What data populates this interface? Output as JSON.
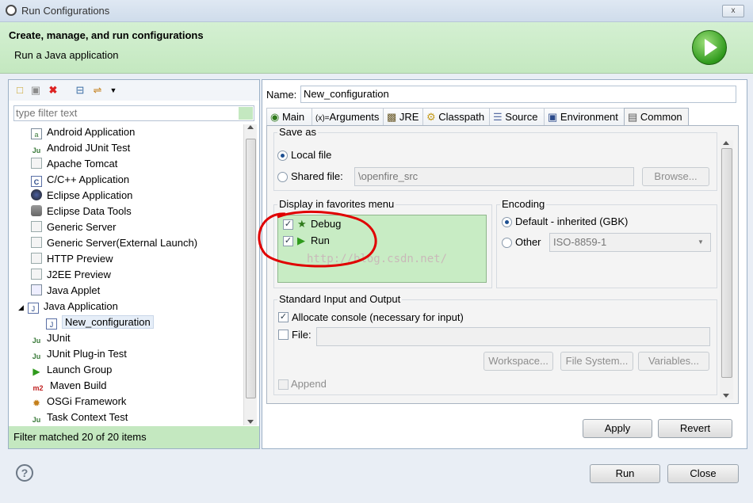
{
  "window": {
    "title": "Run Configurations",
    "close_label": "x"
  },
  "header": {
    "title": "Create, manage, and run configurations",
    "subtitle": "Run a Java application"
  },
  "left": {
    "filter_placeholder": "type filter text",
    "items": [
      {
        "label": "Android Application",
        "icon": "android-app-icon"
      },
      {
        "label": "Android JUnit Test",
        "icon": "junit-icon"
      },
      {
        "label": "Apache Tomcat",
        "icon": "tomcat-icon"
      },
      {
        "label": "C/C++ Application",
        "icon": "c-app-icon"
      },
      {
        "label": "Eclipse Application",
        "icon": "eclipse-icon"
      },
      {
        "label": "Eclipse Data Tools",
        "icon": "database-icon"
      },
      {
        "label": "Generic Server",
        "icon": "server-icon"
      },
      {
        "label": "Generic Server(External Launch)",
        "icon": "server-icon"
      },
      {
        "label": "HTTP Preview",
        "icon": "server-icon"
      },
      {
        "label": "J2EE Preview",
        "icon": "server-icon"
      },
      {
        "label": "Java Applet",
        "icon": "applet-icon"
      },
      {
        "label": "Java Application",
        "icon": "java-app-icon"
      },
      {
        "label": "New_configuration",
        "icon": "java-app-icon"
      },
      {
        "label": "JUnit",
        "icon": "junit-icon"
      },
      {
        "label": "JUnit Plug-in Test",
        "icon": "junit-icon"
      },
      {
        "label": "Launch Group",
        "icon": "launch-group-icon"
      },
      {
        "label": "Maven Build",
        "icon": "maven-icon"
      },
      {
        "label": "OSGi Framework",
        "icon": "osgi-icon"
      },
      {
        "label": "Task Context Test",
        "icon": "junit-icon"
      }
    ],
    "status": "Filter matched 20 of 20 items"
  },
  "config": {
    "name_label": "Name:",
    "name_value": "New_configuration",
    "tabs": [
      "Main",
      "Arguments",
      "JRE",
      "Classpath",
      "Source",
      "Environment",
      "Common"
    ],
    "active_tab": "Common"
  },
  "common": {
    "save_as_title": "Save as",
    "local_file_label": "Local file",
    "shared_file_label": "Shared file:",
    "shared_file_value": "\\openfire_src",
    "browse_label": "Browse...",
    "favorites_title": "Display in favorites menu",
    "debug_label": "Debug",
    "run_label": "Run",
    "encoding_title": "Encoding",
    "default_enc_label": "Default - inherited (GBK)",
    "other_label": "Other",
    "other_value": "ISO-8859-1",
    "stdio_title": "Standard Input and Output",
    "allocate_label": "Allocate console (necessary for input)",
    "file_label": "File:",
    "workspace_label": "Workspace...",
    "filesystem_label": "File System...",
    "variables_label": "Variables...",
    "append_label": "Append"
  },
  "watermark": "http://blog.csdn.net/",
  "buttons": {
    "apply": "Apply",
    "revert": "Revert",
    "run": "Run",
    "close": "Close"
  },
  "colors": {
    "banner": "#c4e8c0",
    "highlight": "#c8ecc4",
    "annotation": "#e00000"
  }
}
